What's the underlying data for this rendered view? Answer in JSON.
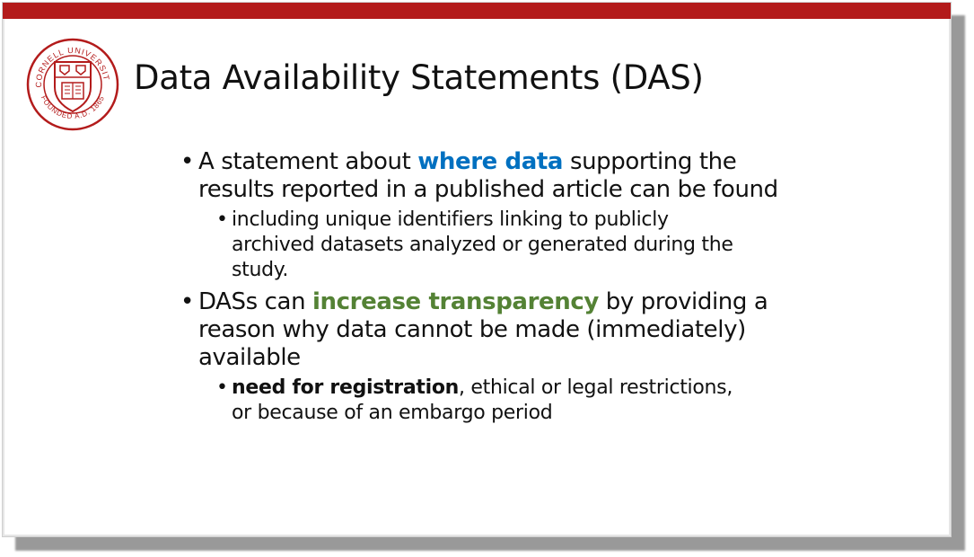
{
  "colors": {
    "brand_red": "#b31b1b",
    "highlight_blue": "#0070c0",
    "highlight_green": "#548235"
  },
  "logo": {
    "name": "cornell-seal",
    "text_top": "CORNELL UNIVERSITY",
    "text_bottom": "FOUNDED A.D. 1865"
  },
  "slide": {
    "title": "Data Availability Statements (DAS)",
    "bullets": [
      {
        "pre": "A statement about ",
        "highlight": "where data",
        "post": " supporting the results reported in a published article can be found",
        "sub": {
          "text": "including unique identifiers linking to publicly archived datasets analyzed or generated during the study."
        }
      },
      {
        "pre": "DASs can ",
        "highlight": "increase transparency",
        "post": " by providing a reason why data cannot be made (immediately) available",
        "sub": {
          "bold": "need for registration",
          "text": ", ethical or legal restrictions, or because of an embargo period"
        }
      }
    ]
  }
}
